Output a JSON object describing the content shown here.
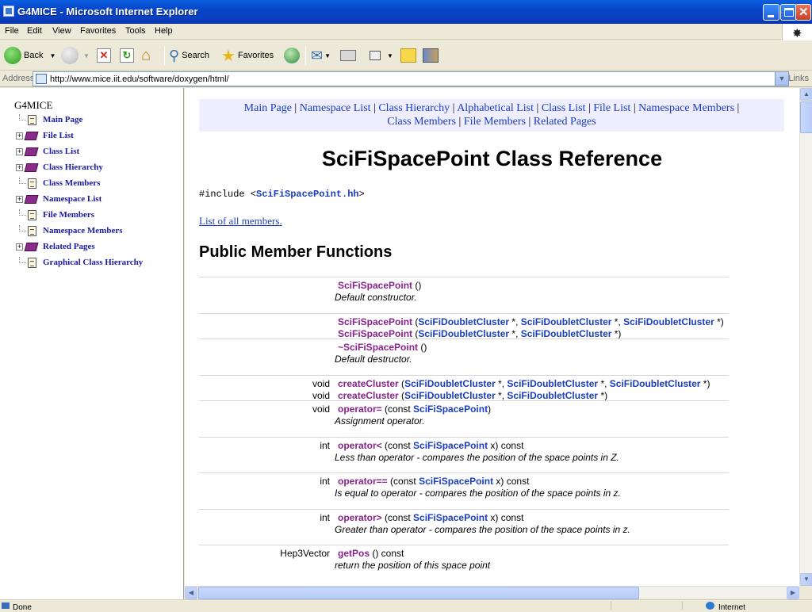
{
  "window": {
    "title": "G4MICE - Microsoft Internet Explorer"
  },
  "menu": [
    "File",
    "Edit",
    "View",
    "Favorites",
    "Tools",
    "Help"
  ],
  "toolbar": {
    "back": "Back",
    "search": "Search",
    "favorites": "Favorites"
  },
  "address": {
    "label": "Address",
    "url": "http://www.mice.iit.edu/software/doxygen/html/",
    "links": "Links"
  },
  "sidebar": {
    "root": "G4MICE",
    "items": [
      {
        "label": "Main Page",
        "icon": "page-icon"
      },
      {
        "label": "File List",
        "icon": "book-icon"
      },
      {
        "label": "Class List",
        "icon": "book-icon"
      },
      {
        "label": "Class Hierarchy",
        "icon": "book-icon"
      },
      {
        "label": "Class Members",
        "icon": "page-icon"
      },
      {
        "label": "Namespace List",
        "icon": "book-icon"
      },
      {
        "label": "File Members",
        "icon": "page-icon"
      },
      {
        "label": "Namespace Members",
        "icon": "page-icon"
      },
      {
        "label": "Related Pages",
        "icon": "book-icon"
      },
      {
        "label": "Graphical Class Hierarchy",
        "icon": "page-icon"
      }
    ]
  },
  "nav": {
    "links": [
      "Main Page",
      "Namespace List",
      "Class Hierarchy",
      "Alphabetical List",
      "Class List",
      "File List",
      "Namespace Members",
      "Class Members",
      "File Members",
      "Related Pages"
    ],
    "sep": " | "
  },
  "page": {
    "title": "SciFiSpacePoint Class Reference",
    "include_prefix": "#include <",
    "include_file": "SciFiSpacePoint.hh",
    "include_suffix": ">",
    "all_members": "List of all members.",
    "section": "Public Member Functions"
  },
  "members": [
    {
      "ret": "",
      "name": "SciFiSpacePoint",
      "sig_parts": [
        {
          "t": " ()",
          "c": false
        }
      ],
      "desc": "Default constructor."
    },
    {
      "ret": "",
      "name": "SciFiSpacePoint",
      "sig_parts": [
        {
          "t": " (",
          "c": false
        },
        {
          "t": "SciFiDoubletCluster",
          "c": true
        },
        {
          "t": " *, ",
          "c": false
        },
        {
          "t": "SciFiDoubletCluster",
          "c": true
        },
        {
          "t": " *, ",
          "c": false
        },
        {
          "t": "SciFiDoubletCluster",
          "c": true
        },
        {
          "t": " *)",
          "c": false
        }
      ],
      "desc": ""
    },
    {
      "ret": "",
      "name": "SciFiSpacePoint",
      "sig_parts": [
        {
          "t": " (",
          "c": false
        },
        {
          "t": "SciFiDoubletCluster",
          "c": true
        },
        {
          "t": " *, ",
          "c": false
        },
        {
          "t": "SciFiDoubletCluster",
          "c": true
        },
        {
          "t": " *)",
          "c": false
        }
      ],
      "desc": ""
    },
    {
      "ret": "",
      "name": "~SciFiSpacePoint",
      "sig_parts": [
        {
          "t": " ()",
          "c": false
        }
      ],
      "desc": "Default destructor."
    },
    {
      "ret": "void",
      "name": "createCluster",
      "sig_parts": [
        {
          "t": " (",
          "c": false
        },
        {
          "t": "SciFiDoubletCluster",
          "c": true
        },
        {
          "t": " *, ",
          "c": false
        },
        {
          "t": "SciFiDoubletCluster",
          "c": true
        },
        {
          "t": " *, ",
          "c": false
        },
        {
          "t": "SciFiDoubletCluster",
          "c": true
        },
        {
          "t": " *)",
          "c": false
        }
      ],
      "desc": ""
    },
    {
      "ret": "void",
      "name": "createCluster",
      "sig_parts": [
        {
          "t": " (",
          "c": false
        },
        {
          "t": "SciFiDoubletCluster",
          "c": true
        },
        {
          "t": " *, ",
          "c": false
        },
        {
          "t": "SciFiDoubletCluster",
          "c": true
        },
        {
          "t": " *)",
          "c": false
        }
      ],
      "desc": ""
    },
    {
      "ret": "void",
      "name": "operator=",
      "sig_parts": [
        {
          "t": " (const ",
          "c": false
        },
        {
          "t": "SciFiSpacePoint",
          "c": true
        },
        {
          "t": ")",
          "c": false
        }
      ],
      "desc": "Assignment operator."
    },
    {
      "ret": "int",
      "name": "operator<",
      "sig_parts": [
        {
          "t": " (const ",
          "c": false
        },
        {
          "t": "SciFiSpacePoint",
          "c": true
        },
        {
          "t": " x) const",
          "c": false
        }
      ],
      "desc": "Less than operator - compares the position of the space points in Z."
    },
    {
      "ret": "int",
      "name": "operator==",
      "sig_parts": [
        {
          "t": " (const ",
          "c": false
        },
        {
          "t": "SciFiSpacePoint",
          "c": true
        },
        {
          "t": " x) const",
          "c": false
        }
      ],
      "desc": "Is equal to operator - compares the position of the space points in z."
    },
    {
      "ret": "int",
      "name": "operator>",
      "sig_parts": [
        {
          "t": " (const ",
          "c": false
        },
        {
          "t": "SciFiSpacePoint",
          "c": true
        },
        {
          "t": " x) const",
          "c": false
        }
      ],
      "desc": "Greater than operator - compares the position of the space points in z."
    },
    {
      "ret": "Hep3Vector",
      "name": "getPos",
      "sig_parts": [
        {
          "t": " () const",
          "c": false
        }
      ],
      "desc": "return the position of this space point"
    }
  ],
  "status": {
    "text": "Done",
    "zone": "Internet"
  },
  "colors": {
    "title_bar": "#0a4fd8",
    "link": "#1a3dc1",
    "function": "#87238a",
    "nav_bg": "#eeeeff"
  }
}
